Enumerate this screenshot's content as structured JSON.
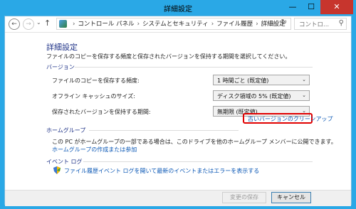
{
  "window": {
    "title": "詳細設定",
    "min": "—",
    "max": "☐",
    "close": "✕"
  },
  "address": {
    "crumbs": [
      "コントロール パネル",
      "システムとセキュリティ",
      "ファイル履歴",
      "詳細設定"
    ],
    "search_placeholder": "コントロ..."
  },
  "main": {
    "title": "詳細設定",
    "description": "ファイルのコピーを保存する頻度と保存されたバージョンを保持する期間を選択してください。",
    "versions": {
      "heading": "バージョン",
      "frequency_label": "ファイルのコピーを保存する頻度:",
      "frequency_value": "1 時間ごと (既定値)",
      "cache_label": "オフライン キャッシュのサイズ:",
      "cache_value": "ディスク領域の 5% (既定値)",
      "keep_label": "保存されたバージョンを保持する期間:",
      "keep_value": "無期限 (既定値)",
      "cleanup_link": "古いバージョンのクリーンアップ"
    },
    "homegroup": {
      "heading": "ホームグループ",
      "text": "この PC がホームグループの一部である場合は、このドライブを他のホームグループ メンバーに公開できます。",
      "link": "ホームグループの作成または参加"
    },
    "eventlog": {
      "heading": "イベント ログ",
      "link": "ファイル履歴イベント ログを開いて最新のイベントまたはエラーを表示する"
    }
  },
  "footer": {
    "save_label": "変更の保存",
    "cancel_label": "キャンセル"
  }
}
